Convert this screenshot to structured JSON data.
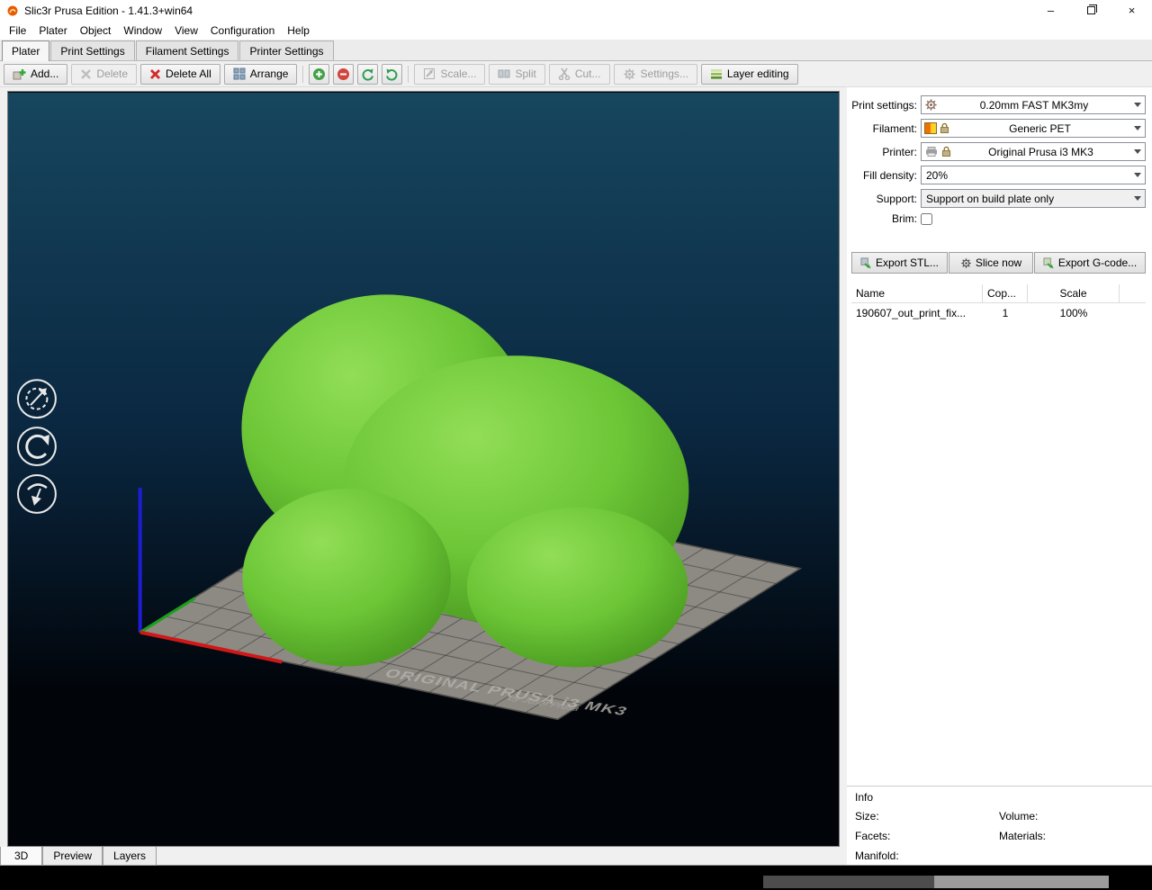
{
  "window": {
    "title": "Slic3r Prusa Edition - 1.41.3+win64",
    "minimize_glyph": "–",
    "close_glyph": "×"
  },
  "menu": {
    "items": [
      "File",
      "Plater",
      "Object",
      "Window",
      "View",
      "Configuration",
      "Help"
    ]
  },
  "tabs": {
    "plater": "Plater",
    "print_settings": "Print Settings",
    "filament_settings": "Filament Settings",
    "printer_settings": "Printer Settings"
  },
  "toolbar": {
    "add": "Add...",
    "delete": "Delete",
    "delete_all": "Delete All",
    "arrange": "Arrange",
    "scale": "Scale...",
    "split": "Split",
    "cut": "Cut...",
    "settings": "Settings...",
    "layer_editing": "Layer editing"
  },
  "viewport": {
    "bed_title": "ORIGINAL PRUSA i3 MK3",
    "bed_subtitle": "by Josef Prusa"
  },
  "view_tabs": {
    "t3d": "3D",
    "preview": "Preview",
    "layers": "Layers"
  },
  "sidebar": {
    "print_settings_label": "Print settings:",
    "print_settings_value": "0.20mm FAST MK3my",
    "filament_label": "Filament:",
    "filament_value": "Generic PET",
    "printer_label": "Printer:",
    "printer_value": "Original Prusa i3 MK3",
    "fill_density_label": "Fill density:",
    "fill_density_value": "20%",
    "support_label": "Support:",
    "support_value": "Support on build plate only",
    "brim_label": "Brim:",
    "brim_checked": false,
    "export_stl": "Export STL...",
    "slice_now": "Slice now",
    "export_gcode": "Export G-code...",
    "table": {
      "col_name": "Name",
      "col_copies": "Cop...",
      "col_scale": "Scale",
      "row": {
        "name": "190607_out_print_fix...",
        "copies": "1",
        "scale": "100%"
      }
    },
    "info": {
      "title": "Info",
      "size_label": "Size:",
      "volume_label": "Volume:",
      "facets_label": "Facets:",
      "materials_label": "Materials:",
      "manifold_label": "Manifold:"
    }
  },
  "colors": {
    "model_green": "#67c233",
    "bed_gray": "#8d8a84",
    "viewport_top_blue": "#17465f",
    "filament_swatch_left": "#f07000",
    "filament_swatch_right": "#ffd02a"
  },
  "icons": [
    "app-icon",
    "gear-icon",
    "lock-icon",
    "printer-icon",
    "dropdown-arrow-icon",
    "add-icon",
    "delete-icon",
    "delete-all-icon",
    "arrange-icon",
    "increase-copies-icon",
    "decrease-copies-icon",
    "rotate-ccw-icon",
    "rotate-cw-icon",
    "scale-icon",
    "split-icon",
    "cut-icon",
    "settings-icon",
    "layer-editing-icon",
    "export-stl-icon",
    "slice-now-icon",
    "export-gcode-icon",
    "rotate-view-icon",
    "undo-rotate-icon",
    "place-on-bed-icon"
  ]
}
